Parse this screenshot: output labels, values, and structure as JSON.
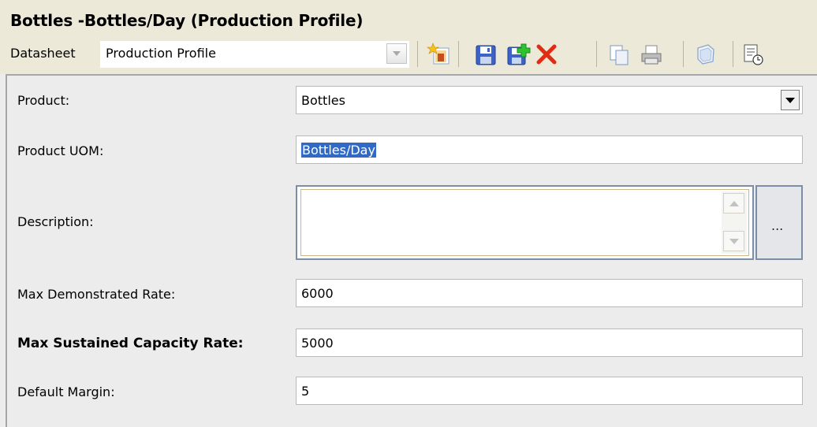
{
  "window": {
    "title": "Bottles -Bottles/Day (Production Profile)"
  },
  "toolbar": {
    "datasheet_label": "Datasheet",
    "datasheet_value": "Production Profile",
    "icons": [
      "new-record-icon",
      "save-icon",
      "save-and-new-icon",
      "delete-icon",
      "copy-icon",
      "print-icon",
      "help-icon",
      "report-icon"
    ]
  },
  "form": {
    "product_label": "Product:",
    "product_value": "Bottles",
    "product_uom_label": "Product UOM:",
    "product_uom_value": "Bottles/Day",
    "description_label": "Description:",
    "description_value": "",
    "description_button": "...",
    "max_demonstrated_rate_label": "Max Demonstrated Rate:",
    "max_demonstrated_rate_value": "6000",
    "max_sustained_capacity_rate_label": "Max Sustained Capacity Rate:",
    "max_sustained_capacity_rate_value": "5000",
    "default_margin_label": "Default Margin:",
    "default_margin_value": "5"
  },
  "colors": {
    "toolbar_bg": "#ece9d8",
    "panel_bg": "#ececec",
    "selection": "#316ac5",
    "delete_red": "#e12b12"
  }
}
